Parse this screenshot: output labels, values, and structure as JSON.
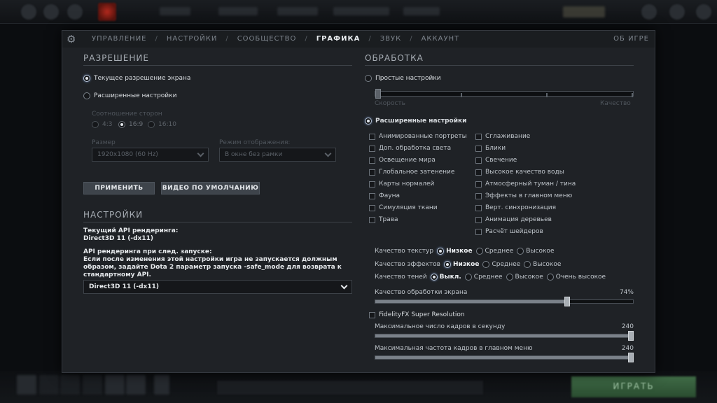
{
  "nav": {
    "tabs": [
      "УПРАВЛЕНИЕ",
      "НАСТРОЙКИ",
      "СООБЩЕСТВО",
      "ГРАФИКА",
      "ЗВУК",
      "АККАУНТ"
    ],
    "active": "ГРАФИКА",
    "about": "ОБ ИГРЕ"
  },
  "resolution": {
    "title": "РАЗРЕШЕНИЕ",
    "current": "Текущее разрешение экрана",
    "advanced": "Расширенные настройки",
    "aspect_label": "Соотношение сторон",
    "aspects": [
      "4:3",
      "16:9",
      "16:10"
    ],
    "size_label": "Размер",
    "size_value": "1920x1080 (60 Hz)",
    "mode_label": "Режим отображения:",
    "mode_value": "В окне без рамки",
    "apply": "ПРИМЕНИТЬ",
    "default_video": "ВИДЕО ПО УМОЛЧАНИЮ"
  },
  "settings": {
    "title": "НАСТРОЙКИ",
    "current_api_label": "Текущий API рендеринга:",
    "current_api_value": "Direct3D 11 (-dx11)",
    "next_api_label": "API рендеринга при след. запуске:",
    "next_api_note": "Если после изменения этой настройки игра не запускается должным образом, задайте Dota 2 параметр запуска -safe_mode для возврата к стандартному API.",
    "api_select": "Direct3D 11 (-dx11)"
  },
  "processing": {
    "title": "ОБРАБОТКА",
    "simple": "Простые настройки",
    "speed": "Скорость",
    "quality": "Качество",
    "advanced": "Расширенные настройки",
    "checks_left": [
      "Анимированные портреты",
      "Доп. обработка света",
      "Освещение мира",
      "Глобальное затенение",
      "Карты нормалей",
      "Фауна",
      "Симуляция ткани",
      "Трава"
    ],
    "checks_right": [
      "Сглаживание",
      "Блики",
      "Свечение",
      "Высокое качество воды",
      "Атмосферный туман / тина",
      "Эффекты в главном меню",
      "Верт. синхронизация",
      "Анимация деревьев",
      "Расчёт шейдеров"
    ],
    "texture_label": "Качество текстур",
    "texture_opts": [
      "Низкое",
      "Среднее",
      "Высокое"
    ],
    "effects_label": "Качество эффектов",
    "effects_opts": [
      "Низкое",
      "Среднее",
      "Высокое"
    ],
    "shadow_label": "Качество теней",
    "shadow_opts": [
      "Выкл.",
      "Среднее",
      "Высокое",
      "Очень высокое"
    ],
    "screen_label": "Качество обработки экрана",
    "screen_value": "74%",
    "screen_fraction": 0.74,
    "fsr": "FidelityFX Super Resolution",
    "fps_label": "Максимальное число кадров в секунду",
    "fps_value": "240",
    "menu_fps_label": "Максимальная частота кадров в главном меню",
    "menu_fps_value": "240"
  },
  "bottom": {
    "play": "ИГРАТЬ"
  }
}
